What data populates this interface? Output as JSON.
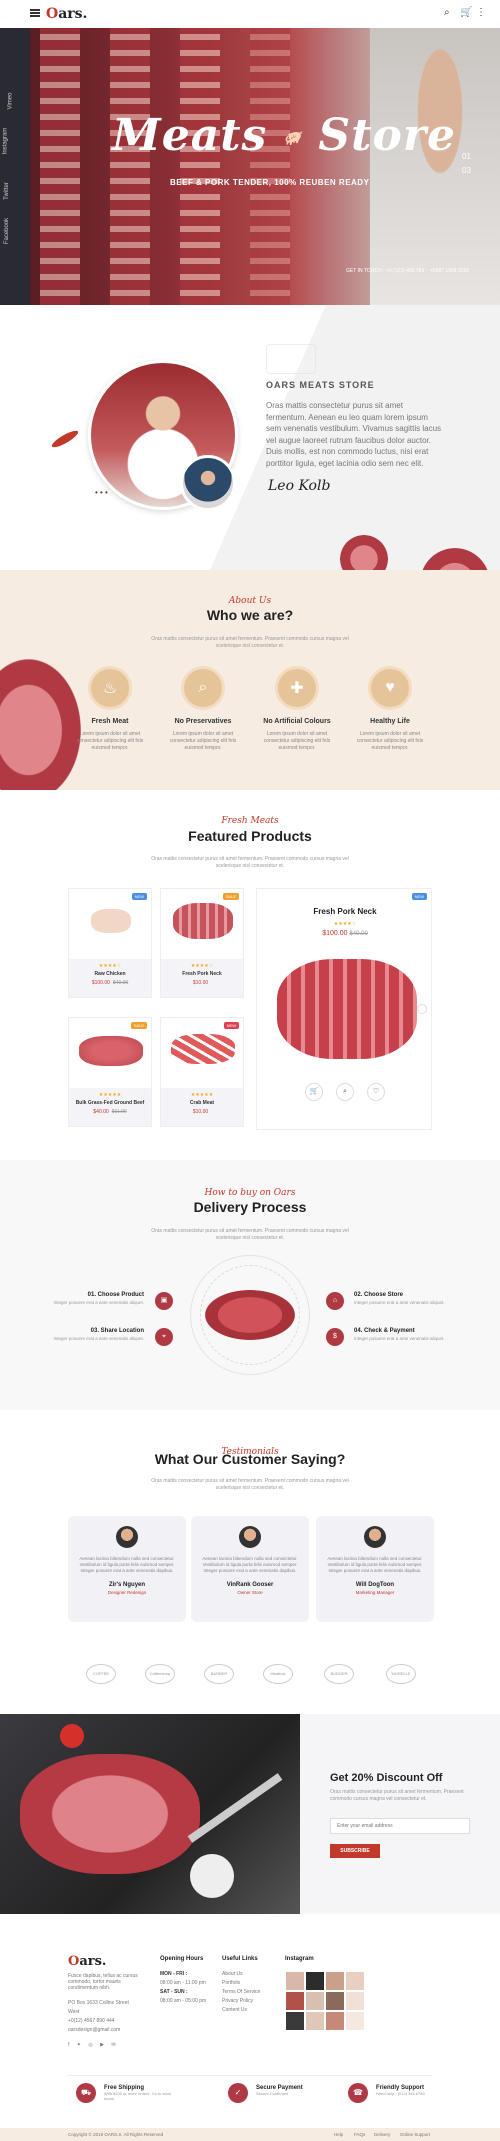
{
  "header": {
    "logo_first": "O",
    "logo_rest": "ars."
  },
  "sidebar": {
    "links": [
      "Facebook",
      "Twitter",
      "Instagram",
      "Vimeo"
    ]
  },
  "hero": {
    "title": "Meats",
    "title2": "Store",
    "subtitle": "BEEF & PORK TENDER, 100% REUBEN READY",
    "slide_current": "01",
    "slide_total": "03",
    "foot_links": [
      "GET IN TOUCH :",
      "+0 (123) 456 789",
      "+0987 1654 3210"
    ]
  },
  "about": {
    "title": "OARS MEATS STORE",
    "text": "Oras mattis consectetur purus sit amet fermentum. Aenean eu leo quam lorem ipsum sem venenatis vestibulum. Vivamus sagittis lacus vel augue laoreet rutrum faucibus dolor auctor. Duis mollis, est non commodo luctus, nisi erat porttitor ligula, eget lacinia odio sem nec elit.",
    "signature": "Leo Kolb"
  },
  "who": {
    "script": "About Us",
    "title": "Who we are?",
    "desc": "Oras mattis consectetur purus sit amet fermentum. Praesent commodo cursus magna vel scelerisque nisl consectetur et.",
    "features": [
      {
        "icon": "♨",
        "title": "Fresh Meat",
        "desc": "Lorem ipsum dolor sit amet consectetur adipiscing elit fels euismod tempor."
      },
      {
        "icon": "⌕",
        "title": "No Preservatives",
        "desc": "Lorem ipsum dolor sit amet consectetur adipiscing elit fels euismod tempor."
      },
      {
        "icon": "✚",
        "title": "No Artificial Colours",
        "desc": "Lorem ipsum dolor sit amet consectetur adipiscing elit fels euismod tempor."
      },
      {
        "icon": "♥",
        "title": "Healthy Life",
        "desc": "Lorem ipsum dolor sit amet consectetur adipiscing elit fels euismod tempor."
      }
    ]
  },
  "products": {
    "script": "Fresh Meats",
    "title": "Featured Products",
    "desc": "Oras mattis consectetur purus sit amet fermentum. Praesent commodo cursus magna vel scelerisque nisl consectetur et.",
    "items": [
      {
        "name": "Raw Chicken",
        "price": "$100.00",
        "old": "$40.00",
        "badge": "NEW",
        "stars": "★★★★☆"
      },
      {
        "name": "Fresh Pork Neck",
        "price": "$10.00",
        "old": "",
        "badge": "SALE",
        "stars": "★★★★☆"
      },
      {
        "name": "Bulk Grass-Fed Ground Beef",
        "price": "$40.00",
        "old": "$11.00",
        "badge": "SALE",
        "stars": "★★★★★"
      },
      {
        "name": "Crab Meat",
        "price": "$10.00",
        "old": "",
        "badge": "NEW",
        "stars": "★★★★★"
      }
    ],
    "featured": {
      "name": "Fresh Pork Neck",
      "price": "$100.00",
      "old": "$40.00",
      "badge": "NEW",
      "stars": "★★★★☆"
    }
  },
  "delivery": {
    "script": "How to buy on Oars",
    "title": "Delivery Process",
    "desc": "Oras mattis consectetur purus sit amet fermentum. Praesent commodo cursus magna vel scelerisque nisl consectetur et.",
    "steps": [
      {
        "title": "01. Choose Product",
        "desc": "Integer posuere erat a ante venenatis aliquet."
      },
      {
        "title": "02. Choose Store",
        "desc": "Integer posuere erat a ante venenatis aliquet."
      },
      {
        "title": "03. Share Location",
        "desc": "Integer posuere erat a ante venenatis aliquet."
      },
      {
        "title": "04. Check & Payment",
        "desc": "Integer posuere erat a ante venenatis aliquet."
      }
    ]
  },
  "testimonials": {
    "script": "Testimonials",
    "title": "What Our Customer Saying?",
    "desc": "Oras mattis consectetur purus sit amet fermentum. Praesent commodo cursus magna vel scelerisque nisl consectetur et.",
    "items": [
      {
        "quote": "Aenean lacinia bibendum nulla sed consectetur. Vestibulum id ligula porta felis euismod semper. Integer posuere erat a ante venenatis dapibus.",
        "name": "Zir's Nguyen",
        "role": "Designer Redesign"
      },
      {
        "quote": "Aenean lacinia bibendum nulla sed consectetur. Vestibulum id ligula porta felis euismod semper. Integer posuere erat a ante venenatis dapibus.",
        "name": "VinRank Gooser",
        "role": "Owner Store"
      },
      {
        "quote": "Aenean lacinia bibendum nulla sed consectetur. Vestibulum id ligula porta felis euismod semper. Integer posuere erat a ante venenatis dapibus.",
        "name": "Will DogToon",
        "role": "Marketing Manager"
      }
    ],
    "brands": [
      "COFFEE",
      "Coffeeshop",
      "BARBER",
      "Meatbox",
      "BURGER",
      "MORELLE"
    ]
  },
  "discount": {
    "title": "Get 20% Discount Off",
    "desc": "Oras mattis consectetur purus sit amet fermentum. Praesent commodo cursus magna vel consectetur et.",
    "placeholder": "Enter your email address",
    "button": "SUBSCRIBE"
  },
  "footer": {
    "about": "Fusce dapibus, tellus ac cursus commodo, tortor mauris condimentum nibh.",
    "address": "PO Box 1633 Collins Street West",
    "phone": "+0(12) 4567 890 444",
    "email": "oarsdesign@gmail.com",
    "hours_title": "Opening Hours",
    "hours": [
      "MON - FRI :",
      "08:00 am - 11:00 pm",
      "SAT - SUN :",
      "08:00 am - 05:00 pm"
    ],
    "links_title": "Useful Links",
    "links": [
      "About Us",
      "Portfolio",
      "Terms Of Service",
      "Privacy Policy",
      "Content Us"
    ],
    "insta_title": "Instagram",
    "services": [
      {
        "icon": "⛟",
        "title": "Free Shipping",
        "desc": "With $100 or more orders. Go to store hours"
      },
      {
        "icon": "✓",
        "title": "Secure Payment",
        "desc": "Secure Confirmed"
      },
      {
        "icon": "☎",
        "title": "Friendly Support",
        "desc": "Need help : (012) 345 6789"
      }
    ],
    "copyright": "Copyright © 2019 OARS.S. All Rights Reserved",
    "bottom_links": [
      "Help",
      "FAQs",
      "Delivery",
      "Online Support"
    ]
  },
  "colors": {
    "accent": "#c0392b",
    "beige": "#f6ece1",
    "gold": "#e5c49a",
    "dark": "#2a2a33"
  }
}
